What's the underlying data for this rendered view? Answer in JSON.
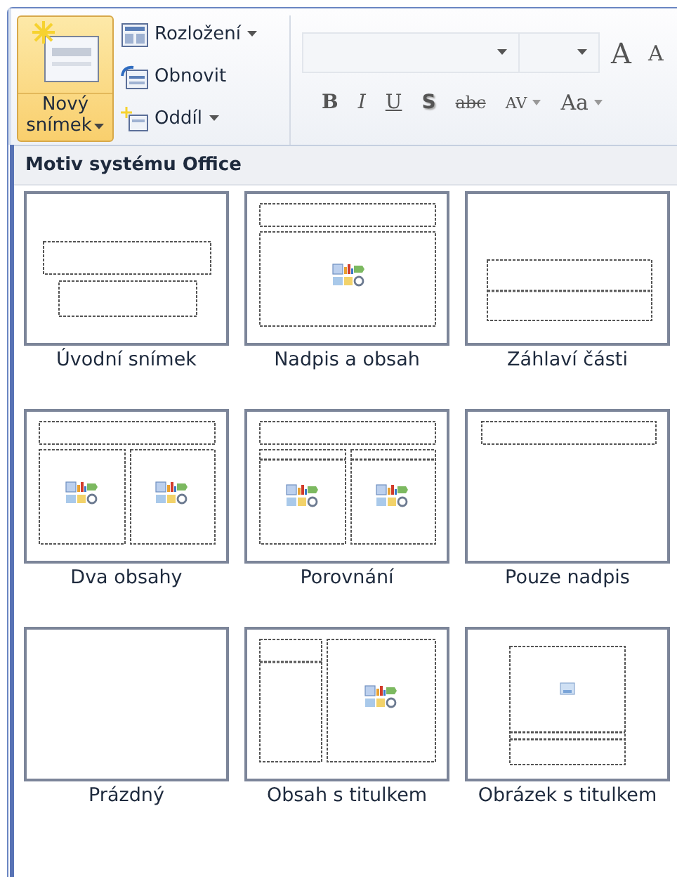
{
  "ribbon": {
    "new_slide": {
      "label_lines": [
        "Nový",
        "snímek"
      ],
      "selected": true
    },
    "small_buttons": [
      {
        "label": "Rozložení",
        "kind": "layout",
        "dropdown": true
      },
      {
        "label": "Obnovit",
        "kind": "reset",
        "dropdown": false
      },
      {
        "label": "Oddíl",
        "kind": "section",
        "dropdown": true
      }
    ],
    "font_size_buttons": [
      {
        "label": "A",
        "kind": "grow"
      },
      {
        "label": "A",
        "kind": "shrink"
      }
    ],
    "format_buttons": [
      {
        "label": "B",
        "kind": "bold",
        "dropdown": false
      },
      {
        "label": "I",
        "kind": "italic",
        "dropdown": false
      },
      {
        "label": "U",
        "kind": "underline",
        "dropdown": false
      },
      {
        "label": "S",
        "kind": "shadow",
        "dropdown": false
      },
      {
        "label": "abc",
        "kind": "strike",
        "dropdown": false
      },
      {
        "label": "AV",
        "kind": "spacing",
        "dropdown": true
      },
      {
        "label": "Aa",
        "kind": "case",
        "dropdown": true
      }
    ]
  },
  "gallery": {
    "title": "Motiv systému Office",
    "layouts": [
      {
        "label": "Úvodní snímek",
        "kind": "title"
      },
      {
        "label": "Nadpis a obsah",
        "kind": "title_content"
      },
      {
        "label": "Záhlaví části",
        "kind": "section"
      },
      {
        "label": "Dva obsahy",
        "kind": "two_content"
      },
      {
        "label": "Porovnání",
        "kind": "comparison"
      },
      {
        "label": "Pouze nadpis",
        "kind": "title_only"
      },
      {
        "label": "Prázdný",
        "kind": "blank"
      },
      {
        "label": "Obsah s titulkem",
        "kind": "content_caption"
      },
      {
        "label": "Obrázek s titulkem",
        "kind": "picture_caption"
      }
    ]
  }
}
